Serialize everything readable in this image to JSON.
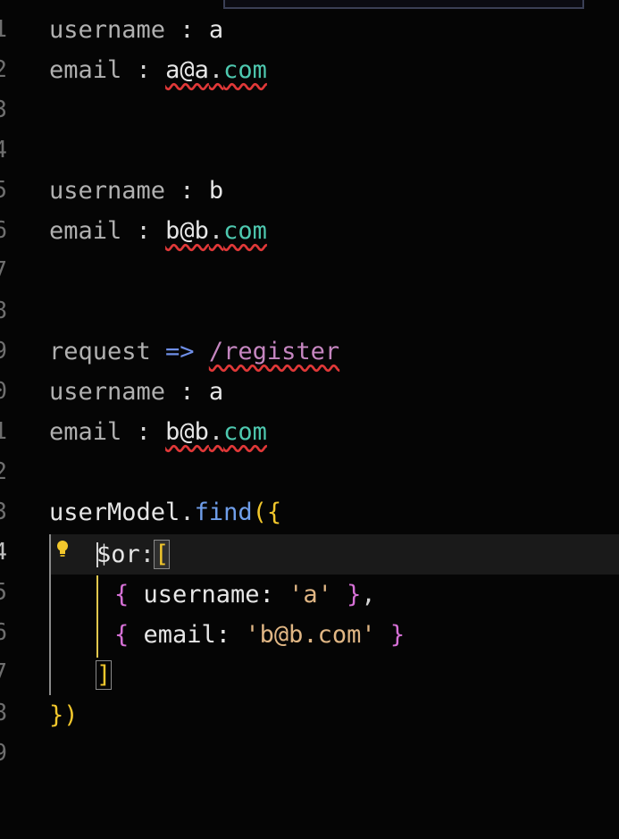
{
  "editor": {
    "line_numbers": [
      "1",
      "2",
      "3",
      "4",
      "5",
      "6",
      "7",
      "8",
      "9",
      "0",
      "1",
      "2",
      "3",
      "4",
      "5",
      "6",
      "7",
      "8",
      "9"
    ],
    "lines": {
      "l1_key": "username",
      "l1_sep": " : ",
      "l1_val": "a",
      "l2_key": "email",
      "l2_sep": " : ",
      "l2_user": "a@a",
      "l2_dot": ".",
      "l2_com": "com",
      "l5_key": "username",
      "l5_sep": " : ",
      "l5_val": "b",
      "l6_key": "email",
      "l6_sep": " : ",
      "l6_user": "b@b",
      "l6_dot": ".",
      "l6_com": "com",
      "l9_req": "request",
      "l9_arrow": " => ",
      "l9_path": "/register",
      "l10_key": "username",
      "l10_sep": " : ",
      "l10_val": "a",
      "l11_key": "email",
      "l11_sep": " : ",
      "l11_user": "b@b",
      "l11_dot": ".",
      "l11_com": "com",
      "l13_obj": "userModel",
      "l13_dot": ".",
      "l13_fn": "find",
      "l13_paren": "(",
      "l13_brace": "{",
      "l14_key": "$or",
      "l14_colon": ":",
      "l14_bracket": "[",
      "l15_open": "{",
      "l15_key": " username: ",
      "l15_str": "'a'",
      "l15_close": " }",
      "l15_comma": ",",
      "l16_open": "{",
      "l16_key": " email: ",
      "l16_str": "'b@b.com'",
      "l16_close": " }",
      "l17_bracket": "]",
      "l18_brace": "}",
      "l18_paren": ")"
    }
  },
  "colors": {
    "background": "#050505",
    "function": "#6f9eea",
    "string": "#e0b684",
    "bracket_gold": "#f2c72c",
    "bracket_pink": "#d670d6",
    "squiggle": "#e03838"
  }
}
